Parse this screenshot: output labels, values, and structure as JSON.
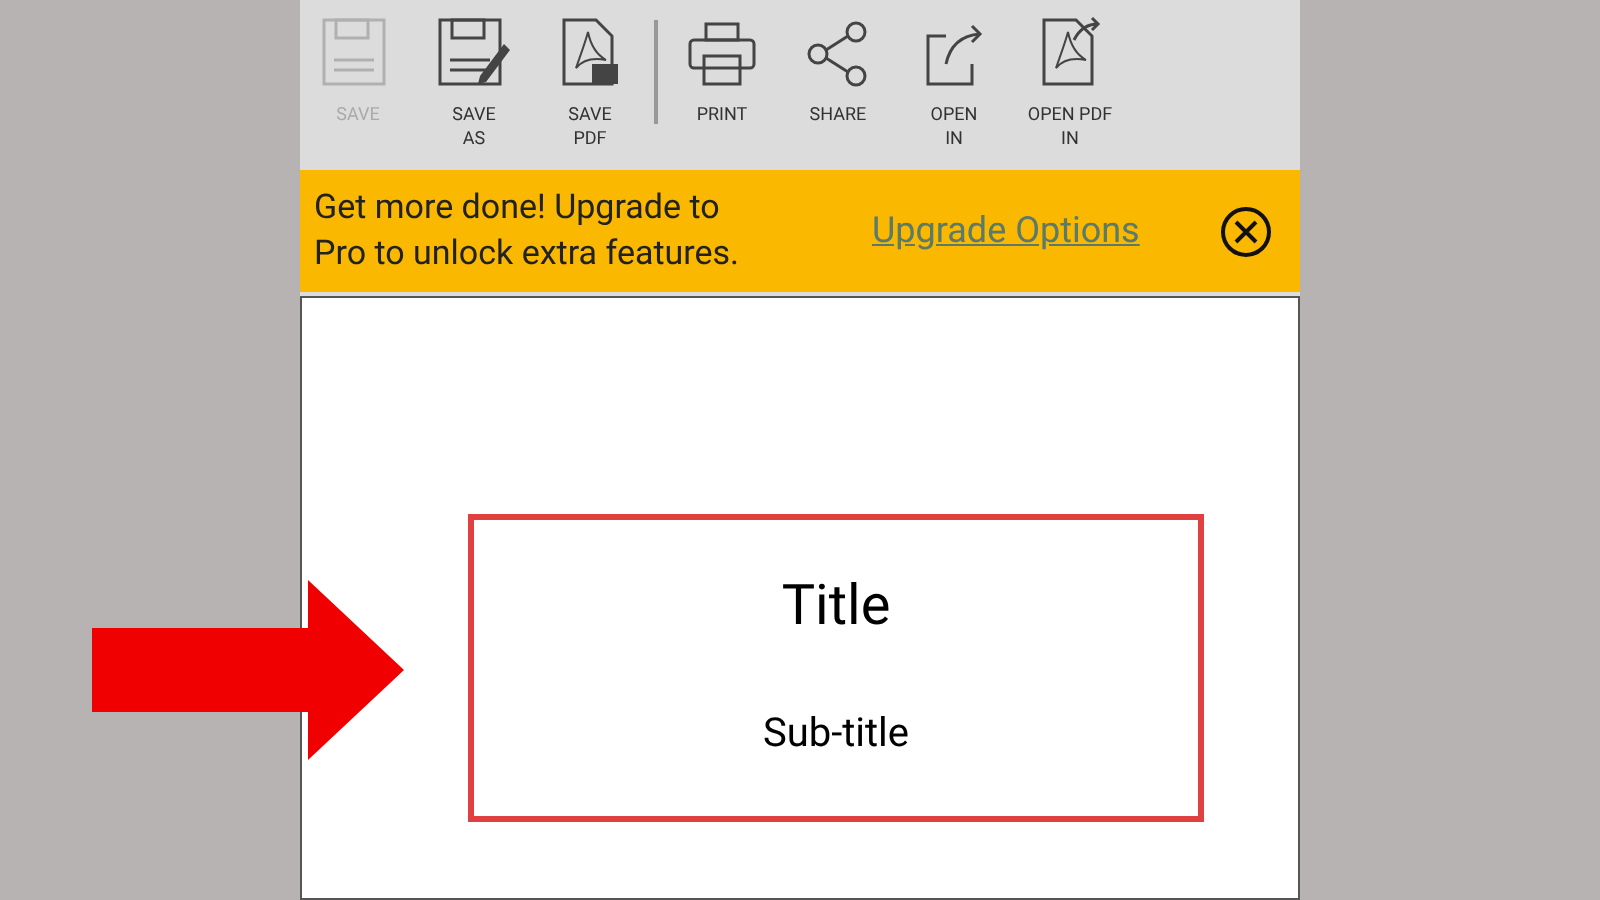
{
  "toolbar": [
    {
      "kind": "save",
      "label": "SAVE",
      "disabled": true
    },
    {
      "kind": "save_as",
      "label": "SAVE\nAS",
      "disabled": false
    },
    {
      "kind": "save_pdf",
      "label": "SAVE\nPDF",
      "disabled": false
    },
    {
      "kind": "separator"
    },
    {
      "kind": "print",
      "label": "PRINT",
      "disabled": false
    },
    {
      "kind": "share",
      "label": "SHARE",
      "disabled": false
    },
    {
      "kind": "open_in",
      "label": "OPEN\nIN",
      "disabled": false
    },
    {
      "kind": "open_pdf_in",
      "label": "OPEN PDF\nIN",
      "disabled": false
    }
  ],
  "banner": {
    "message": "Get more done! Upgrade to\nPro to unlock extra features.",
    "link": "Upgrade Options"
  },
  "slide": {
    "title": "Title",
    "subtitle": "Sub-title"
  }
}
